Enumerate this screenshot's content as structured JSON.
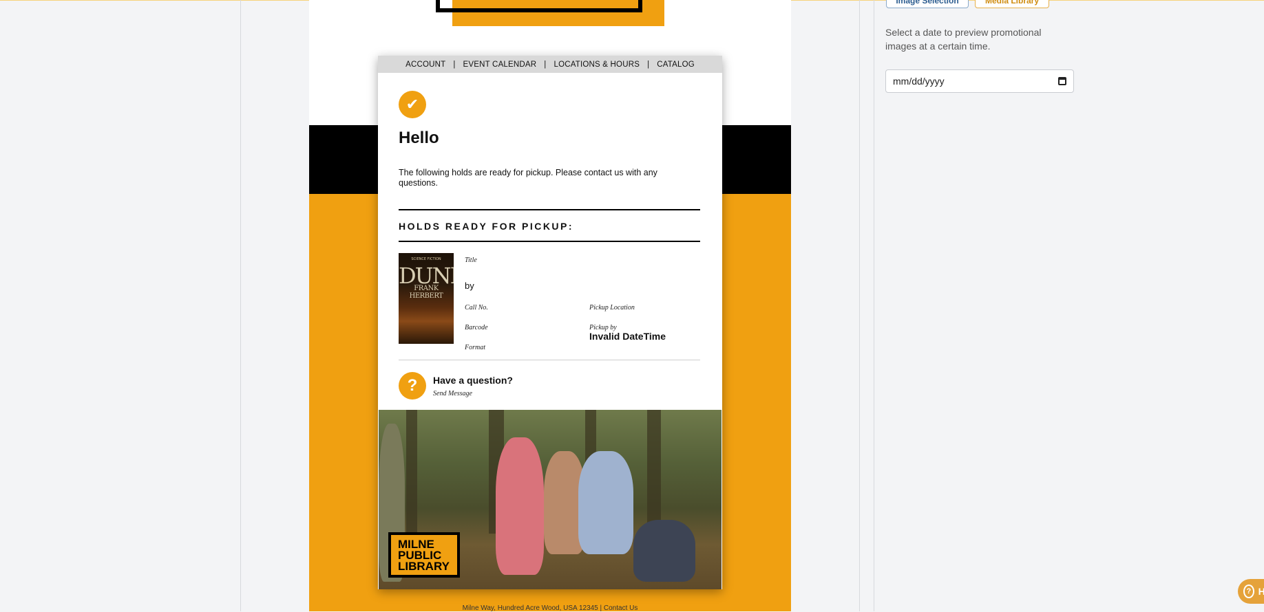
{
  "nav": {
    "items": [
      "ACCOUNT",
      "EVENT CALENDAR",
      "LOCATIONS & HOURS",
      "CATALOG"
    ],
    "separator": "|"
  },
  "email": {
    "greeting": "Hello",
    "intro": "The following holds are ready for pickup. Please contact us with any questions.",
    "section_title": "HOLDS READY FOR PICKUP:",
    "hold": {
      "cover": {
        "series": "SCIENCE FICTION",
        "title": "DUNE",
        "author": "FRANK HERBERT"
      },
      "title_label": "Title",
      "by": "by",
      "call_no_label": "Call No.",
      "pickup_location_label": "Pickup Location",
      "barcode_label": "Barcode",
      "pickup_by_label": "Pickup by",
      "pickup_by_value": "Invalid DateTime",
      "format_label": "Format"
    },
    "question": {
      "title": "Have a question?",
      "link": "Send Message"
    },
    "library_logo": [
      "MILNE",
      "PUBLIC",
      "LIBRARY"
    ],
    "footer": "Milne Way, Hundred Acre Wood, USA 12345 | Contact Us"
  },
  "sidebar": {
    "buttons": {
      "image_selection": "Image Selection",
      "media_library": "Media Library"
    },
    "help_text": "Select a date to preview promotional images at a certain time.",
    "date_placeholder": "mm/dd/yyyy"
  },
  "help_widget": {
    "label": "Help"
  },
  "colors": {
    "accent": "#f0a011",
    "black": "#000000",
    "nav_bg": "#d9d9d9"
  }
}
